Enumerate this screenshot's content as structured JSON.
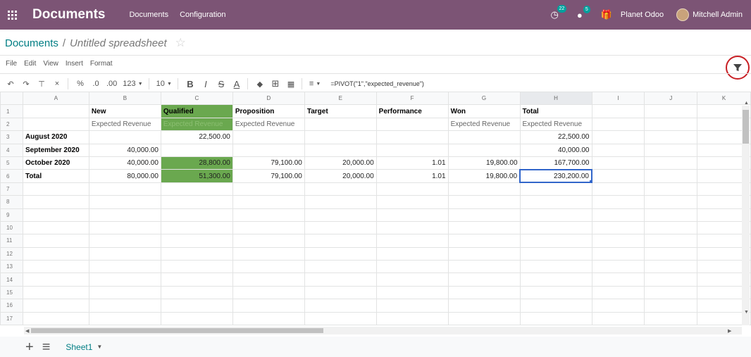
{
  "navbar": {
    "brand": "Documents",
    "links": [
      "Documents",
      "Configuration"
    ],
    "activity_count": "22",
    "messages_count": "5",
    "company": "Planet Odoo",
    "user": "Mitchell Admin"
  },
  "breadcrumb": {
    "parent": "Documents",
    "separator": "/",
    "current": "Untitled spreadsheet"
  },
  "menu": [
    "File",
    "Edit",
    "View",
    "Insert",
    "Format"
  ],
  "toolbar": {
    "percent": "%",
    "decrease_decimals": ".0",
    "increase_decimals": ".00",
    "number_format": "123",
    "font_size": "10",
    "bold": "B",
    "italic": "I",
    "strike": "S",
    "text_color": "A",
    "formula": "=PIVOT(\"1\",\"expected_revenue\")"
  },
  "grid": {
    "columns": [
      "A",
      "B",
      "C",
      "D",
      "E",
      "F",
      "G",
      "H",
      "I",
      "J",
      "K"
    ],
    "selected_column": "H",
    "rows": [
      [
        "",
        "New",
        "Qualified",
        "Proposition",
        "Target",
        "Performance",
        "Won",
        "Total",
        "",
        "",
        ""
      ],
      [
        "",
        "Expected Revenue",
        "Expected Revenue",
        "Expected Revenue",
        "",
        "",
        "Expected Revenue",
        "Expected Revenue",
        "",
        "",
        ""
      ],
      [
        "August 2020",
        "",
        "22,500.00",
        "",
        "",
        "",
        "",
        "22,500.00",
        "",
        "",
        ""
      ],
      [
        "September 2020",
        "40,000.00",
        "",
        "",
        "",
        "",
        "",
        "40,000.00",
        "",
        "",
        ""
      ],
      [
        "October 2020",
        "40,000.00",
        "28,800.00",
        "79,100.00",
        "20,000.00",
        "1.01",
        "19,800.00",
        "167,700.00",
        "",
        "",
        ""
      ],
      [
        "Total",
        "80,000.00",
        "51,300.00",
        "79,100.00",
        "20,000.00",
        "1.01",
        "19,800.00",
        "230,200.00",
        "",
        "",
        ""
      ],
      [
        "",
        "",
        "",
        "",
        "",
        "",
        "",
        "",
        "",
        "",
        ""
      ],
      [
        "",
        "",
        "",
        "",
        "",
        "",
        "",
        "",
        "",
        "",
        ""
      ],
      [
        "",
        "",
        "",
        "",
        "",
        "",
        "",
        "",
        "",
        "",
        ""
      ],
      [
        "",
        "",
        "",
        "",
        "",
        "",
        "",
        "",
        "",
        "",
        ""
      ],
      [
        "",
        "",
        "",
        "",
        "",
        "",
        "",
        "",
        "",
        "",
        ""
      ],
      [
        "",
        "",
        "",
        "",
        "",
        "",
        "",
        "",
        "",
        "",
        ""
      ],
      [
        "",
        "",
        "",
        "",
        "",
        "",
        "",
        "",
        "",
        "",
        ""
      ],
      [
        "",
        "",
        "",
        "",
        "",
        "",
        "",
        "",
        "",
        "",
        ""
      ],
      [
        "",
        "",
        "",
        "",
        "",
        "",
        "",
        "",
        "",
        "",
        ""
      ],
      [
        "",
        "",
        "",
        "",
        "",
        "",
        "",
        "",
        "",
        "",
        ""
      ],
      [
        "",
        "",
        "",
        "",
        "",
        "",
        "",
        "",
        "",
        "",
        ""
      ]
    ],
    "highlight_color": "#6aa84f",
    "active_cell": "H6"
  },
  "sheets": [
    "Sheet1"
  ]
}
